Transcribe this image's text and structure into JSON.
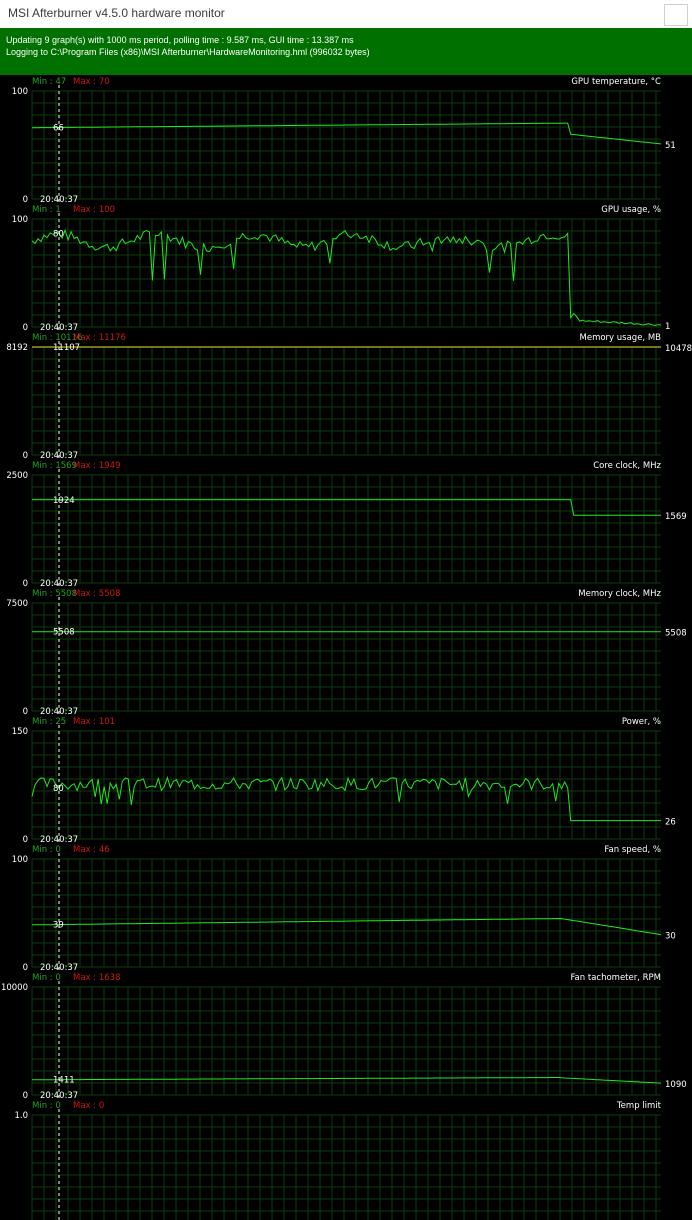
{
  "window": {
    "title": "MSI Afterburner v4.5.0 hardware monitor"
  },
  "status": {
    "line1": "Updating 9 graph(s) with 1000 ms period, polling time : 9.587 ms, GUI time : 13.387 ms",
    "line2": "Logging to C:\\Program Files (x86)\\MSI Afterburner\\HardwareMonitoring.hml (996032 bytes)"
  },
  "colors": {
    "background": "#000000",
    "grid": "#0c3a0c",
    "line": "#22e822",
    "min_text": "#1fa81f",
    "max_text": "#cc1818",
    "label_text": "#ffffff",
    "status_bg": "#007100",
    "memory_line": "#e8e820"
  },
  "graphs": [
    {
      "id": "gpu-temperature",
      "name": "GPU temperature, °C",
      "min_label": "Min : 47",
      "max_label": "Max : 70",
      "top_label": "100",
      "bottom_label": "0",
      "ymin": 0,
      "ymax": 100,
      "cursor_value": "66",
      "current_value": "51",
      "time": "20:40:37",
      "pattern": "temp"
    },
    {
      "id": "gpu-usage",
      "name": "GPU usage, %",
      "min_label": "Min : 1",
      "max_label": "Max : 100",
      "top_label": "100",
      "bottom_label": "0",
      "ymin": 0,
      "ymax": 100,
      "cursor_value": "80",
      "current_value": "1",
      "time": "20:40:37",
      "pattern": "usage"
    },
    {
      "id": "memory-usage",
      "name": "Memory usage, MB",
      "min_label": "Min : 10116",
      "max_label": "Max : 11176",
      "top_label": "8192",
      "bottom_label": "0",
      "ymin": 0,
      "ymax": 8192,
      "cursor_value": "11107",
      "current_value": "10478",
      "time": "20:40:37",
      "pattern": "memory"
    },
    {
      "id": "core-clock",
      "name": "Core clock, MHz",
      "min_label": "Min : 1569",
      "max_label": "Max : 1949",
      "top_label": "2500",
      "bottom_label": "0",
      "ymin": 0,
      "ymax": 2500,
      "cursor_value": "1924",
      "current_value": "1569",
      "time": "20:40:37",
      "pattern": "core"
    },
    {
      "id": "memory-clock",
      "name": "Memory clock, MHz",
      "min_label": "Min : 5508",
      "max_label": "Max : 5508",
      "top_label": "7500",
      "bottom_label": "0",
      "ymin": 0,
      "ymax": 7500,
      "cursor_value": "5508",
      "current_value": "5508",
      "time": "20:40:37",
      "pattern": "flat"
    },
    {
      "id": "power",
      "name": "Power, %",
      "min_label": "Min : 25",
      "max_label": "Max : 101",
      "top_label": "150",
      "bottom_label": "0",
      "ymin": 0,
      "ymax": 150,
      "cursor_value": "80",
      "current_value": "26",
      "time": "20:40:37",
      "pattern": "power"
    },
    {
      "id": "fan-speed",
      "name": "Fan speed, %",
      "min_label": "Min : 0",
      "max_label": "Max : 46",
      "top_label": "100",
      "bottom_label": "0",
      "ymin": 0,
      "ymax": 100,
      "cursor_value": "39",
      "current_value": "30",
      "time": "20:40:37",
      "pattern": "fan"
    },
    {
      "id": "fan-tachometer",
      "name": "Fan tachometer, RPM",
      "min_label": "Min : 0",
      "max_label": "Max : 1638",
      "top_label": "10000",
      "bottom_label": "0",
      "ymin": 0,
      "ymax": 10000,
      "cursor_value": "1411",
      "current_value": "1090",
      "time": "20:40:37",
      "pattern": "tach"
    },
    {
      "id": "temp-limit",
      "name": "Temp limit",
      "min_label": "Min : 0",
      "max_label": "Max : 0",
      "top_label": "1.0",
      "bottom_label": "",
      "ymin": 0,
      "ymax": 1,
      "cursor_value": "",
      "current_value": "",
      "time": "",
      "pattern": "none"
    }
  ]
}
